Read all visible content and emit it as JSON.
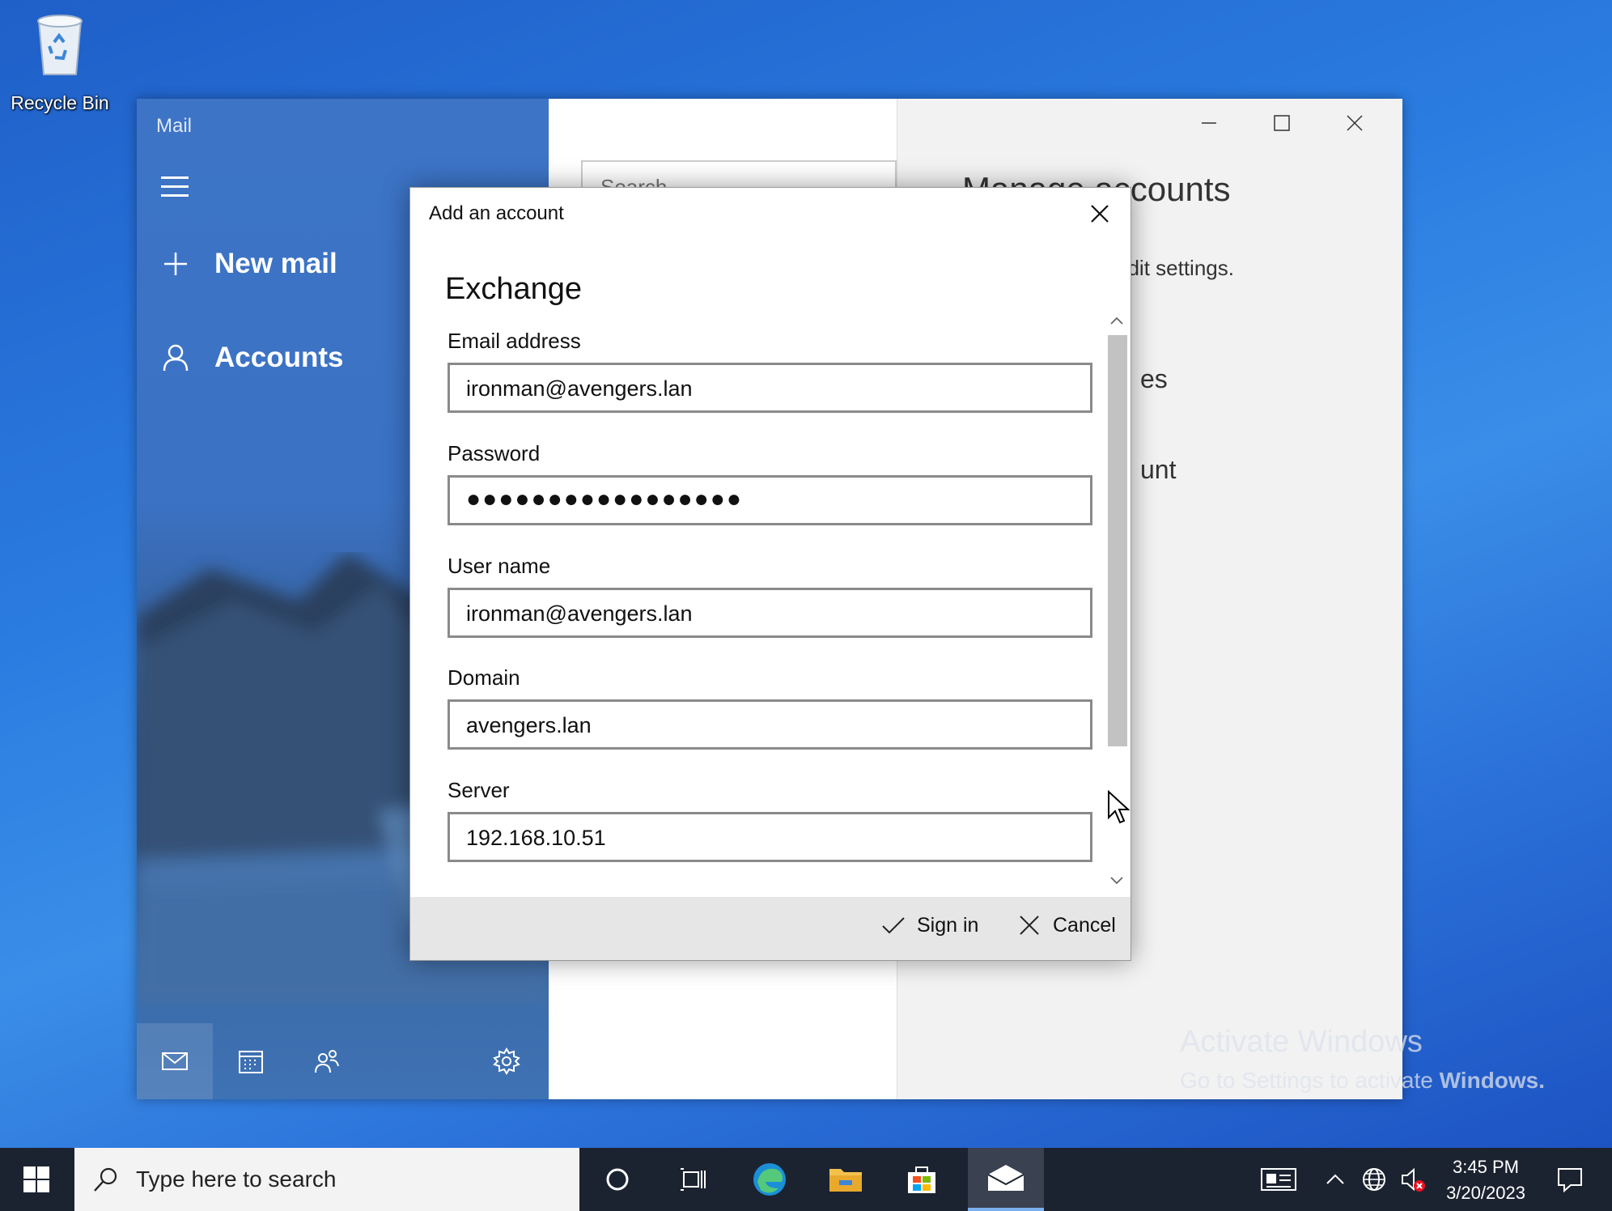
{
  "desktop": {
    "recycle_bin_label": "Recycle Bin"
  },
  "mail": {
    "app_title": "Mail",
    "new_mail_label": "New mail",
    "accounts_label": "Accounts",
    "search_placeholder": "Search",
    "manage_title": "Manage accounts",
    "manage_text_partial": "edit settings.",
    "manage_item1_partial": "es",
    "manage_item2_partial": "unt"
  },
  "dialog": {
    "title": "Add an account",
    "heading": "Exchange",
    "fields": [
      {
        "label": "Email address",
        "value": "ironman@avengers.lan"
      },
      {
        "label": "Password",
        "value": "●●●●●●●●●●●●●●●●●"
      },
      {
        "label": "User name",
        "value": "ironman@avengers.lan"
      },
      {
        "label": "Domain",
        "value": "avengers.lan"
      },
      {
        "label": "Server",
        "value": "192.168.10.51"
      }
    ],
    "sign_in_label": "Sign in",
    "cancel_label": "Cancel"
  },
  "watermark": {
    "line1": "Activate Windows",
    "line2_prefix": "Go to Settings to activate ",
    "line2_bold": "Windows."
  },
  "taskbar": {
    "search_placeholder": "Type here to search",
    "time": "3:45 PM",
    "date": "3/20/2023"
  }
}
